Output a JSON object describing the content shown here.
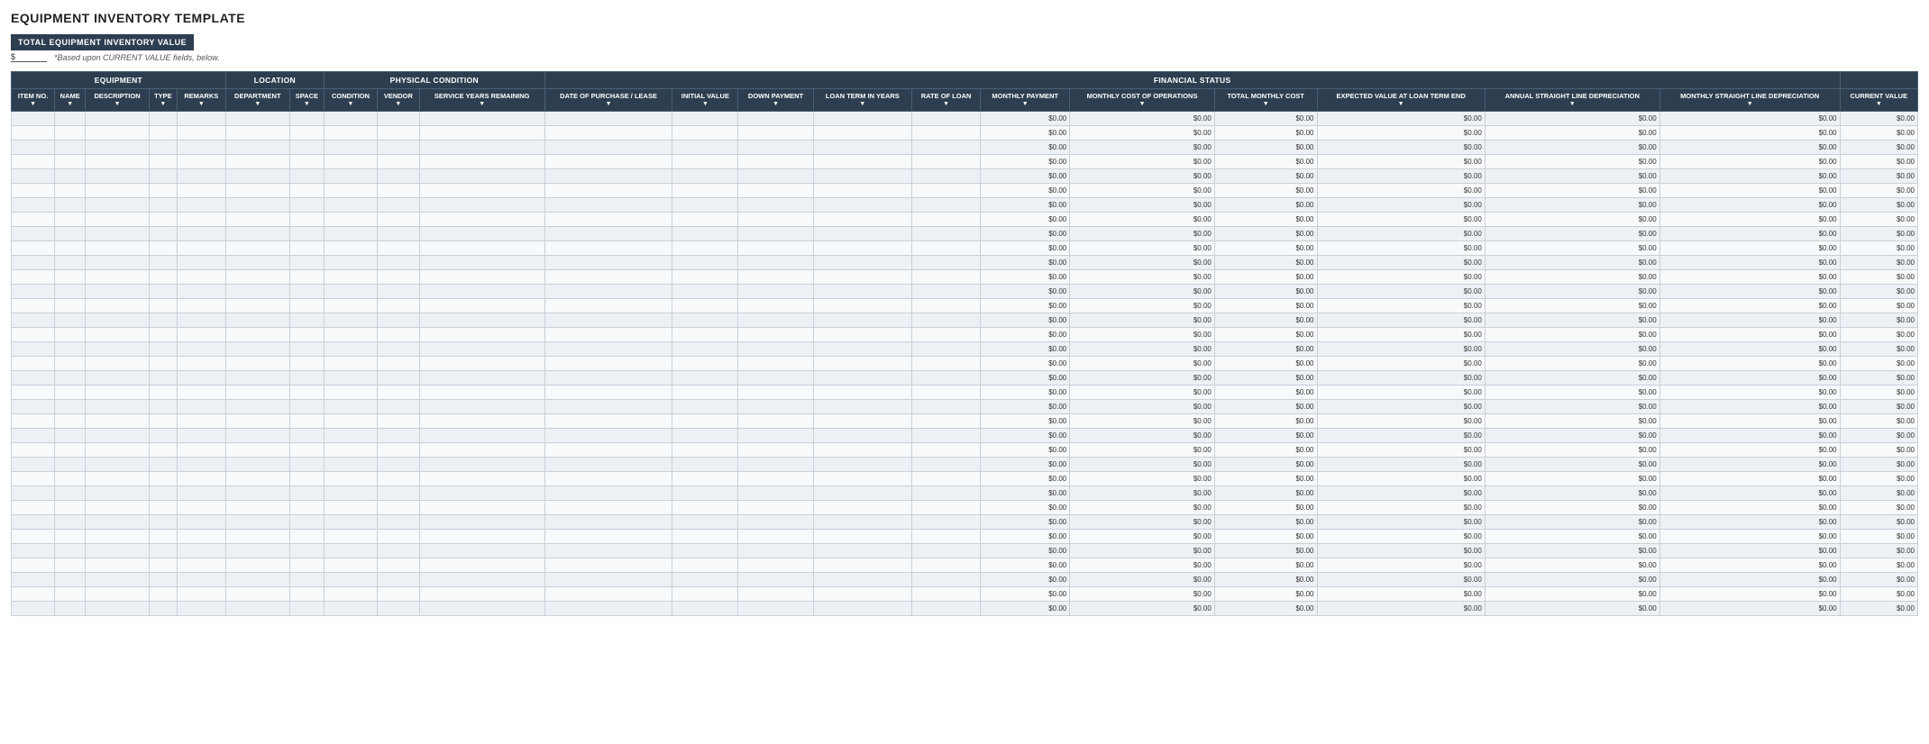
{
  "page": {
    "title": "EQUIPMENT INVENTORY TEMPLATE"
  },
  "summary": {
    "label": "TOTAL EQUIPMENT INVENTORY VALUE",
    "value": "$",
    "note": "*Based upon CURRENT VALUE fields, below."
  },
  "table": {
    "group_headers": [
      {
        "label": "EQUIPMENT",
        "colspan": 5
      },
      {
        "label": "LOCATION",
        "colspan": 2
      },
      {
        "label": "PHYSICAL CONDITION",
        "colspan": 3
      },
      {
        "label": "FINANCIAL STATUS",
        "colspan": 11
      }
    ],
    "columns": [
      {
        "label": "ITEM NO.",
        "key": "item_no"
      },
      {
        "label": "NAME",
        "key": "name"
      },
      {
        "label": "DESCRIPTION",
        "key": "description"
      },
      {
        "label": "TYPE",
        "key": "type"
      },
      {
        "label": "REMARKS",
        "key": "remarks"
      },
      {
        "label": "DEPARTMENT",
        "key": "department"
      },
      {
        "label": "SPACE",
        "key": "space"
      },
      {
        "label": "CONDITION",
        "key": "condition"
      },
      {
        "label": "VENDOR",
        "key": "vendor"
      },
      {
        "label": "SERVICE YEARS REMAINING",
        "key": "service_years"
      },
      {
        "label": "DATE OF PURCHASE / LEASE",
        "key": "purchase_date"
      },
      {
        "label": "INITIAL VALUE",
        "key": "initial_value"
      },
      {
        "label": "DOWN PAYMENT",
        "key": "down_payment"
      },
      {
        "label": "LOAN TERM IN YEARS",
        "key": "loan_term"
      },
      {
        "label": "RATE OF LOAN",
        "key": "rate_of_loan"
      },
      {
        "label": "MONTHLY PAYMENT",
        "key": "monthly_payment"
      },
      {
        "label": "MONTHLY COST OF OPERATIONS",
        "key": "monthly_cost_ops"
      },
      {
        "label": "TOTAL MONTHLY COST",
        "key": "total_monthly_cost"
      },
      {
        "label": "EXPECTED VALUE AT LOAN TERM END",
        "key": "expected_value"
      },
      {
        "label": "ANNUAL STRAIGHT LINE DEPRECIATION",
        "key": "annual_depreciation"
      },
      {
        "label": "MONTHLY STRAIGHT LINE DEPRECIATION",
        "key": "monthly_depreciation"
      },
      {
        "label": "CURRENT VALUE",
        "key": "current_value"
      }
    ],
    "empty_row_count": 35,
    "default_money_value": "$0.00"
  }
}
